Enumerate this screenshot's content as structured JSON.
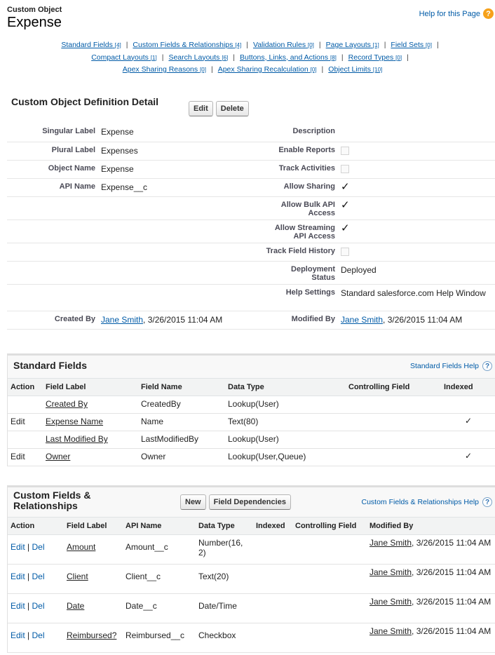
{
  "header": {
    "object_type": "Custom Object",
    "object_name": "Expense",
    "help_link": "Help for this Page",
    "help_icon_glyph": "?"
  },
  "related_links": [
    {
      "label": "Standard Fields",
      "count": "[4]"
    },
    {
      "label": "Custom Fields & Relationships",
      "count": "[4]"
    },
    {
      "label": "Validation Rules",
      "count": "[0]"
    },
    {
      "label": "Page Layouts",
      "count": "[1]"
    },
    {
      "label": "Field Sets",
      "count": "[0]"
    },
    {
      "label": "Compact Layouts",
      "count": "[1]"
    },
    {
      "label": "Search Layouts",
      "count": "[6]"
    },
    {
      "label": "Buttons, Links, and Actions",
      "count": "[8]"
    },
    {
      "label": "Record Types",
      "count": "[0]"
    },
    {
      "label": "Apex Sharing Reasons",
      "count": "[0]"
    },
    {
      "label": "Apex Sharing Recalculation",
      "count": "[0]"
    },
    {
      "label": "Object Limits",
      "count": "[10]"
    }
  ],
  "detail": {
    "title": "Custom Object Definition Detail",
    "edit_label": "Edit",
    "delete_label": "Delete",
    "singular_label": {
      "label": "Singular Label",
      "value": "Expense"
    },
    "plural_label": {
      "label": "Plural Label",
      "value": "Expenses"
    },
    "object_name": {
      "label": "Object Name",
      "value": "Expense"
    },
    "api_name": {
      "label": "API Name",
      "value": "Expense__c"
    },
    "description": {
      "label": "Description",
      "value": ""
    },
    "enable_reports": {
      "label": "Enable Reports",
      "checked": false
    },
    "track_activities": {
      "label": "Track Activities",
      "checked": false
    },
    "allow_sharing": {
      "label": "Allow Sharing",
      "checked": true
    },
    "allow_bulk": {
      "label": "Allow Bulk API Access",
      "checked": true
    },
    "allow_streaming": {
      "label": "Allow Streaming API Access",
      "checked": true
    },
    "track_history": {
      "label": "Track Field History",
      "checked": false
    },
    "deployment_status": {
      "label": "Deployment Status",
      "value": "Deployed"
    },
    "help_settings": {
      "label": "Help Settings",
      "value": "Standard salesforce.com Help Window"
    },
    "created_by": {
      "label": "Created By",
      "user": "Jane Smith",
      "date": ", 3/26/2015 11:04 AM"
    },
    "modified_by": {
      "label": "Modified By",
      "user": "Jane Smith",
      "date": ", 3/26/2015 11:04 AM"
    },
    "check_glyph": "✓"
  },
  "standard_fields": {
    "title": "Standard Fields",
    "help": "Standard Fields Help",
    "help_glyph": "?",
    "columns": [
      "Action",
      "Field Label",
      "Field Name",
      "Data Type",
      "Controlling Field",
      "Indexed"
    ],
    "rows": [
      {
        "action": "",
        "label": "Created By",
        "name": "CreatedBy",
        "type": "Lookup(User)",
        "controlling": "",
        "indexed": ""
      },
      {
        "action": "Edit",
        "label": "Expense Name",
        "name": "Name",
        "type": "Text(80)",
        "controlling": "",
        "indexed": "✓"
      },
      {
        "action": "",
        "label": "Last Modified By",
        "name": "LastModifiedBy",
        "type": "Lookup(User)",
        "controlling": "",
        "indexed": ""
      },
      {
        "action": "Edit",
        "label": "Owner",
        "name": "Owner",
        "type": "Lookup(User,Queue)",
        "controlling": "",
        "indexed": "✓"
      }
    ]
  },
  "custom_fields": {
    "title": "Custom Fields & Relationships",
    "new_label": "New",
    "deps_label": "Field Dependencies",
    "help": "Custom Fields & Relationships Help",
    "help_glyph": "?",
    "columns": [
      "Action",
      "Field Label",
      "API Name",
      "Data Type",
      "Indexed",
      "Controlling Field",
      "Modified By"
    ],
    "edit": "Edit",
    "sep": " | ",
    "del": "Del",
    "rows": [
      {
        "label": "Amount",
        "api": "Amount__c",
        "type": "Number(16, 2)",
        "indexed": "",
        "controlling": "",
        "user": "Jane Smith",
        "date": ", 3/26/2015 11:04 AM"
      },
      {
        "label": "Client",
        "api": "Client__c",
        "type": "Text(20)",
        "indexed": "",
        "controlling": "",
        "user": "Jane Smith",
        "date": ", 3/26/2015 11:04 AM"
      },
      {
        "label": "Date",
        "api": "Date__c",
        "type": "Date/Time",
        "indexed": "",
        "controlling": "",
        "user": "Jane Smith",
        "date": ", 3/26/2015 11:04 AM"
      },
      {
        "label": "Reimbursed?",
        "api": "Reimbursed__c",
        "type": "Checkbox",
        "indexed": "",
        "controlling": "",
        "user": "Jane Smith",
        "date": ", 3/26/2015 11:04 AM"
      }
    ]
  }
}
